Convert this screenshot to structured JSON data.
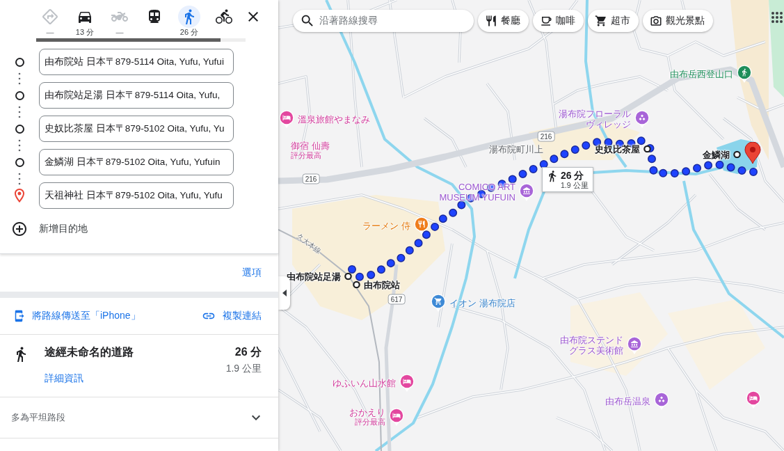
{
  "travel_modes": [
    {
      "kind": "best",
      "time": "—",
      "selected": false,
      "disabled": true
    },
    {
      "kind": "car",
      "time": "13 分",
      "selected": false,
      "disabled": false
    },
    {
      "kind": "motorcycle",
      "time": "—",
      "selected": false,
      "disabled": true
    },
    {
      "kind": "transit",
      "selected": false,
      "disabled": false
    },
    {
      "kind": "walk",
      "time": "26 分",
      "selected": true,
      "disabled": false
    },
    {
      "kind": "bicycle",
      "selected": false,
      "disabled": false
    }
  ],
  "loading_bar": {
    "level": 0.88
  },
  "waypoints": [
    {
      "kind": "stop",
      "value": "由布院站 日本〒879-5114 Oita, Yufu, Yufui"
    },
    {
      "kind": "stop",
      "value": "由布院站足湯 日本〒879-5114 Oita, Yufu,"
    },
    {
      "kind": "stop",
      "value": "史奴比茶屋 日本〒879-5102 Oita, Yufu, Yu"
    },
    {
      "kind": "stop",
      "value": "金鱗湖 日本〒879-5102 Oita, Yufu, Yufuin"
    },
    {
      "kind": "destination",
      "value": "天祖神社 日本〒879-5102 Oita, Yufu, Yufu"
    }
  ],
  "add_destination": "新增目的地",
  "options_link": "選項",
  "share": {
    "send_to_phone": "將路線傳送至「iPhone」",
    "copy_link": "複製連結"
  },
  "route": {
    "via": "途經未命名的道路",
    "duration": "26 分",
    "distance": "1.9 公里",
    "details_link": "詳細資訊"
  },
  "terrain": {
    "label": "多為平坦路段",
    "expanded": false
  },
  "map": {
    "search": {
      "placeholder": "沿著路線搜尋"
    },
    "chips": [
      {
        "kind": "restaurant",
        "label": "餐廳"
      },
      {
        "kind": "cafe",
        "label": "咖啡"
      },
      {
        "kind": "grocery",
        "label": "超市"
      },
      {
        "kind": "attraction",
        "label": "觀光景點"
      }
    ],
    "places": [
      {
        "kind": "hotel",
        "name": "溫泉旅館やまなみ"
      },
      {
        "kind": "hotel",
        "name": "御宿 仙壽",
        "note": "評分最高"
      },
      {
        "kind": "attraction",
        "name_lines": [
          "湯布院フローラル",
          "ヴィレッジ"
        ]
      },
      {
        "kind": "trailhead",
        "name": "由布岳西登山口"
      },
      {
        "kind": "locality",
        "name": "湯布院町川上"
      },
      {
        "kind": "waypoint",
        "name": "史奴比茶屋"
      },
      {
        "kind": "waypoint",
        "name": "金鱗湖"
      },
      {
        "kind": "museum",
        "name_lines": [
          "COMICO ART",
          "MUSEUM YUFUIN"
        ]
      },
      {
        "kind": "restaurant",
        "name": "ラーメン 侍"
      },
      {
        "kind": "railway",
        "name": "久大本線"
      },
      {
        "kind": "waypoint",
        "name": "由布院站足湯"
      },
      {
        "kind": "waypoint",
        "name": "由布院站"
      },
      {
        "kind": "shopping",
        "name": "イオン 湯布院店"
      },
      {
        "kind": "museum",
        "name_lines": [
          "由布院ステンド",
          "グラス美術館"
        ]
      },
      {
        "kind": "hotel",
        "name": "ゆふいん山水館"
      },
      {
        "kind": "hotel",
        "name": "おかえり",
        "note": "評分最高"
      },
      {
        "kind": "attraction",
        "name": "由布岳温泉"
      },
      {
        "kind": "hotel"
      }
    ],
    "road_shields": [
      "216",
      "216",
      "617"
    ],
    "route_callout": {
      "duration": "26 分",
      "distance": "1.9 公里"
    }
  }
}
